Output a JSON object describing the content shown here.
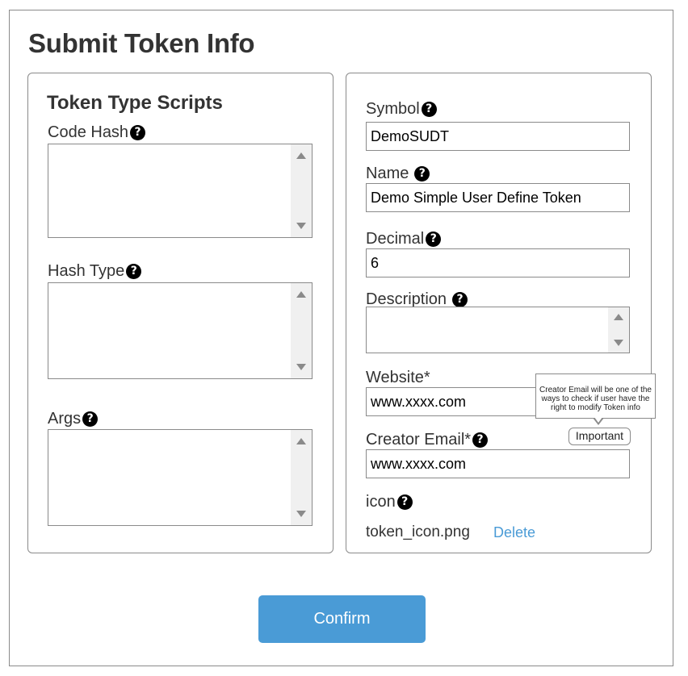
{
  "page": {
    "title": "Submit Token Info"
  },
  "left_panel": {
    "section_title": "Token Type Scripts",
    "code_hash": {
      "label": "Code Hash",
      "value": ""
    },
    "hash_type": {
      "label": "Hash Type",
      "value": ""
    },
    "args": {
      "label": "Args",
      "value": ""
    }
  },
  "right_panel": {
    "symbol": {
      "label": "Symbol",
      "value": "DemoSUDT"
    },
    "name": {
      "label": "Name",
      "value": "Demo Simple User Define Token"
    },
    "decimal": {
      "label": "Decimal",
      "value": "6"
    },
    "description": {
      "label": "Description",
      "value": ""
    },
    "website": {
      "label": "Website*",
      "value": "www.xxxx.com"
    },
    "creator_email": {
      "label": "Creator Email*",
      "value": "www.xxxx.com"
    },
    "icon": {
      "label": "icon",
      "file_name": "token_icon.png",
      "delete_label": "Delete"
    }
  },
  "tooltip": {
    "text": "Creator Email will be one of the ways to check if user have the right to modify Token info",
    "badge": "Important"
  },
  "confirm_button": {
    "label": "Confirm"
  },
  "icons": {
    "help": "question-circle-icon",
    "help_glyph": "?"
  },
  "colors": {
    "accent": "#4a9bd6",
    "border": "#8a8a8a",
    "text": "#333333"
  }
}
